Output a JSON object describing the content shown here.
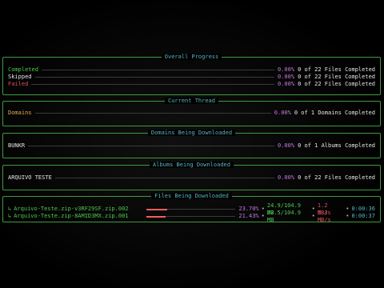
{
  "overall": {
    "title": "Overall Progress",
    "rows": [
      {
        "label": "Completed",
        "pct": "0.00%",
        "status": "0 of 22 Files Completed"
      },
      {
        "label": "Skipped",
        "pct": "0.00%",
        "status": "0 of 22 Files Completed"
      },
      {
        "label": "Failed",
        "pct": "0.00%",
        "status": "0 of 22 Files Completed"
      }
    ]
  },
  "thread": {
    "title": "Current Thread",
    "label": "Domains",
    "pct": "0.00%",
    "status": "0 of 1 Domains Completed"
  },
  "domains": {
    "title": "Domains Being Downloaded",
    "label": "BUNKR",
    "pct": "0.00%",
    "status": "0 of 1 Albums Completed"
  },
  "albums": {
    "title": "Albums Being Downloaded",
    "label": "ARQUIVO TESTE",
    "pct": "0.00%",
    "status": "0 of 22 Files Completed"
  },
  "files": {
    "title": "Files Being Downloaded",
    "arrow": "↳",
    "items": [
      {
        "name": "Arquivo-Teste.zip-v3RF29SF.zip.002",
        "progress": 0.237,
        "pct": "23.70%",
        "size": "24.9/104.9 MB",
        "speed": "1.2 MB/s",
        "eta": "0:00:36"
      },
      {
        "name": "Arquivo-Teste.zip-8AMID3MX.zip.001",
        "progress": 0.214,
        "pct": "21.43%",
        "size": "22.5/104.9 MB",
        "speed": "1.3 MB/s",
        "eta": "0:00:37"
      }
    ]
  },
  "colors": {
    "border": "#3f9a3f",
    "title": "#56b6c2",
    "percent": "#c678dd",
    "completed": "#4ec94e",
    "failed": "#e05252"
  }
}
